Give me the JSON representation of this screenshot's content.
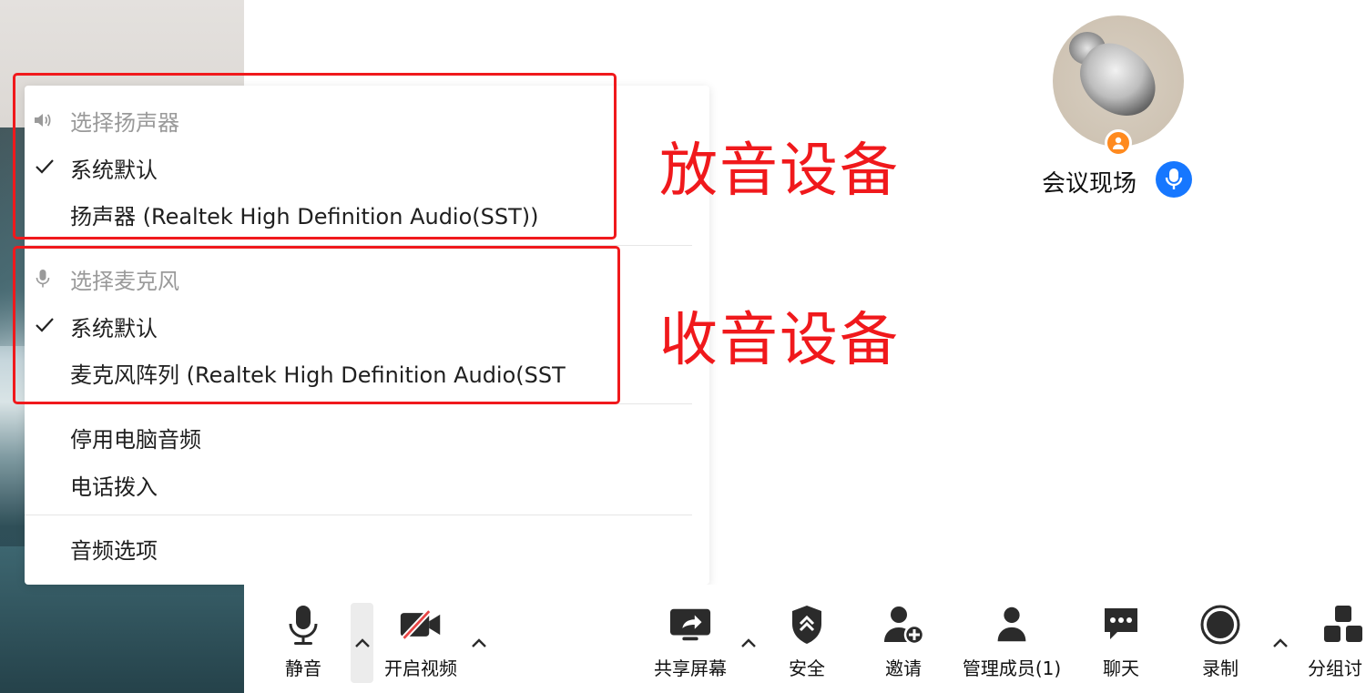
{
  "menu": {
    "speaker_header": "选择扬声器",
    "speaker_default": "系统默认",
    "speaker_device": "扬声器 (Realtek High Definition Audio(SST))",
    "mic_header": "选择麦克风",
    "mic_default": "系统默认",
    "mic_device": "麦克风阵列 (Realtek High Definition Audio(SST",
    "disable_audio": "停用电脑音频",
    "phone_dial_in": "电话拨入",
    "audio_options": "音频选项"
  },
  "annotations": {
    "playback_label": "放音设备",
    "capture_label": "收音设备",
    "color": "#f0191c"
  },
  "participant": {
    "name": "会议现场",
    "host_badge_icon": "person-icon",
    "mic_icon": "microphone-icon",
    "mic_color": "#1677ff",
    "badge_color": "#ff8a1e"
  },
  "toolbar": {
    "mute_label": "静音",
    "video_label": "开启视频",
    "share_label": "共享屏幕",
    "security_label": "安全",
    "invite_label": "邀请",
    "participants_label": "管理成员(1)",
    "chat_label": "聊天",
    "record_label": "录制",
    "breakout_label": "分组讨"
  }
}
